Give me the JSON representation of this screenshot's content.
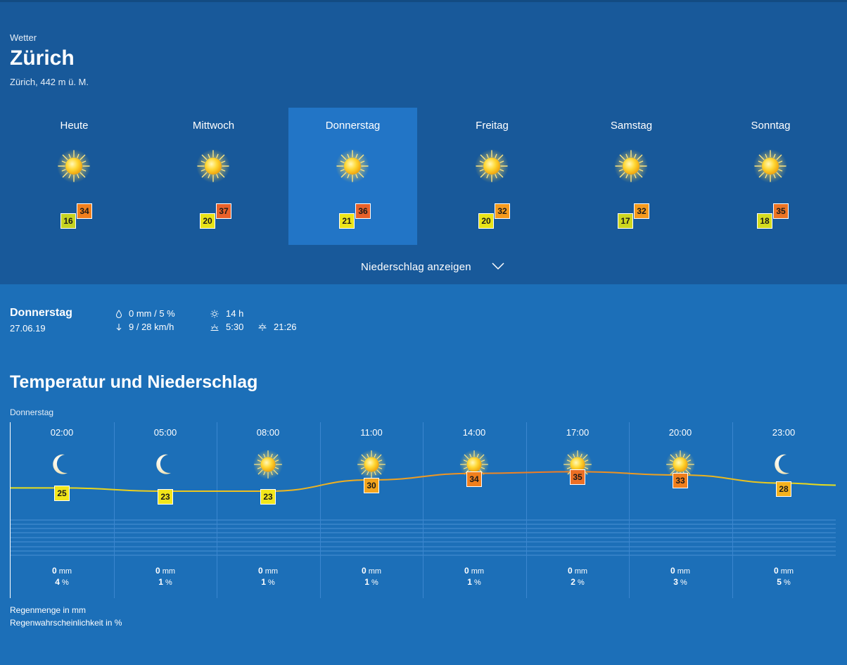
{
  "header": {
    "section": "Wetter",
    "city": "Zürich",
    "altitude": "Zürich, 442 m ü. M."
  },
  "days": [
    {
      "name": "Heute",
      "min": "16",
      "max": "34",
      "min_color": "#c6d321",
      "max_color": "#f07f1d",
      "icon": "sun-icon"
    },
    {
      "name": "Mittwoch",
      "min": "20",
      "max": "37",
      "min_color": "#e9e317",
      "max_color": "#e8612a",
      "icon": "sun-icon"
    },
    {
      "name": "Donnerstag",
      "min": "21",
      "max": "36",
      "min_color": "#ede51a",
      "max_color": "#e8612a",
      "icon": "sun-icon",
      "selected": true
    },
    {
      "name": "Freitag",
      "min": "20",
      "max": "32",
      "min_color": "#e9e317",
      "max_color": "#f59a1d",
      "icon": "sun-icon"
    },
    {
      "name": "Samstag",
      "min": "17",
      "max": "32",
      "min_color": "#cdd61e",
      "max_color": "#f59a1d",
      "icon": "sun-icon"
    },
    {
      "name": "Sonntag",
      "min": "18",
      "max": "35",
      "min_color": "#d6dc1e",
      "max_color": "#ec7424",
      "icon": "sun-icon"
    }
  ],
  "precip_toggle": "Niederschlag anzeigen",
  "selected": {
    "day": "Donnerstag",
    "date": "27.06.19",
    "rain": "0 mm / 5 %",
    "wind": "9 / 28 km/h",
    "sunshine": "14 h",
    "sunrise": "5:30",
    "sunset": "21:26"
  },
  "chart": {
    "title": "Temperatur und Niederschlag",
    "day_label": "Donnerstag",
    "legend_rain_amount": "Regenmenge in mm",
    "legend_rain_prob": "Regenwahrscheinlichkeit in %"
  },
  "chart_data": {
    "type": "line",
    "x": [
      "02:00",
      "05:00",
      "08:00",
      "11:00",
      "14:00",
      "17:00",
      "20:00",
      "23:00"
    ],
    "series": [
      {
        "values": [
          25,
          23,
          23,
          30,
          34,
          35,
          33,
          28
        ]
      }
    ],
    "icons": [
      "moon-icon",
      "moon-icon",
      "sun-icon",
      "sun-icon",
      "sun-icon",
      "sun-icon",
      "sun-icon",
      "moon-icon"
    ],
    "temp_colors": [
      "#f2e61a",
      "#f2e61a",
      "#f2e61a",
      "#f5a51d",
      "#f07f1d",
      "#ec6f24",
      "#f07f1d",
      "#f5b21d"
    ],
    "precip_mm": [
      "0",
      "0",
      "0",
      "0",
      "0",
      "0",
      "0",
      "0"
    ],
    "precip_unit": "mm",
    "precip_pct": [
      "4",
      "1",
      "1",
      "1",
      "1",
      "2",
      "3",
      "5"
    ],
    "pct_unit": "%"
  }
}
